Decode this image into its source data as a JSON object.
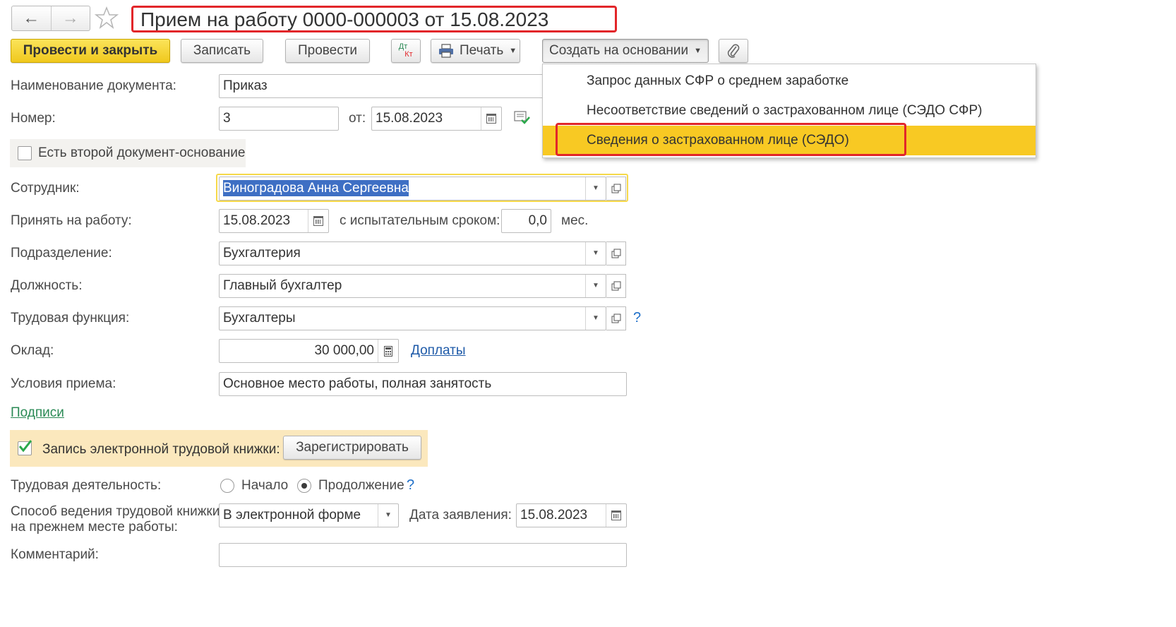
{
  "window": {
    "title": "Прием на работу 0000-000003 от 15.08.2023",
    "nav_back": "←",
    "nav_forward": "→",
    "favorite_icon": "star-icon"
  },
  "toolbar": {
    "post_close": "Провести и закрыть",
    "save": "Записать",
    "post": "Провести",
    "dtkt_top": "Дт",
    "dtkt_bottom": "Кт",
    "print": "Печать",
    "create_based": "Создать на основании",
    "attach_icon": "paperclip-icon"
  },
  "dropdown_menu": {
    "items": [
      "Запрос данных СФР о среднем заработке",
      "Несоответствие сведений о застрахованном лице (СЭДО СФР)",
      "Сведения о застрахованном лице (СЭДО)"
    ],
    "selected_index": 2
  },
  "form": {
    "doc_name_label": "Наименование документа:",
    "doc_name_value": "Приказ",
    "number_label": "Номер:",
    "number_value": "3",
    "date_from_label": "от:",
    "date_value": "15.08.2023",
    "second_doc_label": "Есть второй документ-основание",
    "employee_label": "Сотрудник:",
    "employee_value": "Виноградова Анна Сергеевна",
    "hire_label": "Принять на работу:",
    "hire_date": "15.08.2023",
    "probation_label": "с испытательным сроком:",
    "probation_value": "0,0",
    "probation_unit": "мес.",
    "department_label": "Подразделение:",
    "department_value": "Бухгалтерия",
    "position_label": "Должность:",
    "position_value": "Главный бухгалтер",
    "labor_function_label": "Трудовая функция:",
    "labor_function_value": "Бухгалтеры",
    "help_mark": "?",
    "salary_label": "Оклад:",
    "salary_value": "30 000,00",
    "allowances_link": "Доплаты",
    "conditions_label": "Условия приема:",
    "conditions_value": "Основное место работы, полная занятость",
    "signatures_link": "Подписи",
    "etk_label": "Запись электронной трудовой книжки:",
    "register_button": "Зарегистрировать",
    "labor_activity_label": "Трудовая деятельность:",
    "radio_start": "Начало",
    "radio_continue": "Продолжение",
    "workbook_label_line1": "Способ ведения трудовой книжки",
    "workbook_label_line2": "на прежнем месте работы:",
    "workbook_value": "В электронной форме",
    "application_date_label": "Дата заявления:",
    "application_date_value": "15.08.2023",
    "comment_label": "Комментарий:",
    "comment_value": ""
  },
  "colors": {
    "accent_yellow": "#f8c923",
    "highlight_red": "#e2262a",
    "link_blue": "#1e5aa8",
    "link_green": "#2a8a55",
    "panel_beige": "#fbe8bd"
  }
}
